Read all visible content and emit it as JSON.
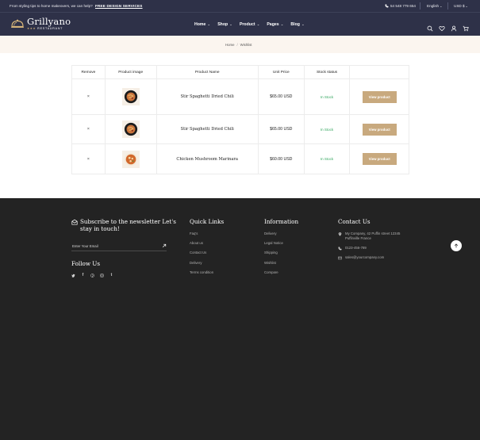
{
  "topbar": {
    "promo_text": "From styling tips to home makeovers, we can help?",
    "promo_link": "FREE DESIGN SERVICES",
    "phone": "54 548 779 654",
    "language": "English",
    "currency": "USD $"
  },
  "header": {
    "logo_name": "Grillyano",
    "logo_sub": "RESTAURANT",
    "logo_stars": "★★★",
    "nav": [
      {
        "label": "Home"
      },
      {
        "label": "Shop"
      },
      {
        "label": "Product"
      },
      {
        "label": "Pages"
      },
      {
        "label": "Blog"
      }
    ],
    "icons": [
      "search-icon",
      "heart-icon",
      "user-icon",
      "cart-icon"
    ]
  },
  "breadcrumb": {
    "home": "Home",
    "separator": "/",
    "current": "Wishlist"
  },
  "wishlist": {
    "columns": [
      "Remove",
      "Product image",
      "Product Name",
      "Unit Price",
      "Stock status",
      ""
    ],
    "rows": [
      {
        "remove": "×",
        "name": "Stir Spaghetti Dried Chili",
        "price": "$65.00 USD",
        "stock": "In Stock",
        "button": "View product"
      },
      {
        "remove": "×",
        "name": "Stir Spaghetti Dried Chili",
        "price": "$65.00 USD",
        "stock": "In Stock",
        "button": "View product"
      },
      {
        "remove": "×",
        "name": "Chicken Mushroom Marinara",
        "price": "$60.00 USD",
        "stock": "In Stock",
        "button": "View product"
      }
    ]
  },
  "footer": {
    "subscribe_title": "Subscribe to the newsletter Let's stay in touch!",
    "email_placeholder": "Enter Your Email",
    "follow_title": "Follow Us",
    "social_icons": [
      "twitter-icon",
      "facebook-icon",
      "pinterest-icon",
      "instagram-icon",
      "tumblr-icon"
    ],
    "quick_links": {
      "title": "Quick Links",
      "items": [
        "Faq's",
        "About us",
        "Contact Us",
        "Delivery",
        "Terms condition"
      ]
    },
    "information": {
      "title": "Information",
      "items": [
        "Delivery",
        "Legal Notice",
        "Shipping",
        "Wishlist",
        "Compare"
      ]
    },
    "contact": {
      "title": "Contact Us",
      "address": "My Company, 42 Puffin street 12345 Puffinville France",
      "phone": "0123-456-789",
      "email": "sales@yourcompany.com"
    }
  },
  "colors": {
    "header_bg": "#2e3148",
    "accent": "#c8a97e",
    "in_stock": "#35a760",
    "footer_bg": "#232323",
    "breadcrumb_bg": "#fbf5ef"
  }
}
